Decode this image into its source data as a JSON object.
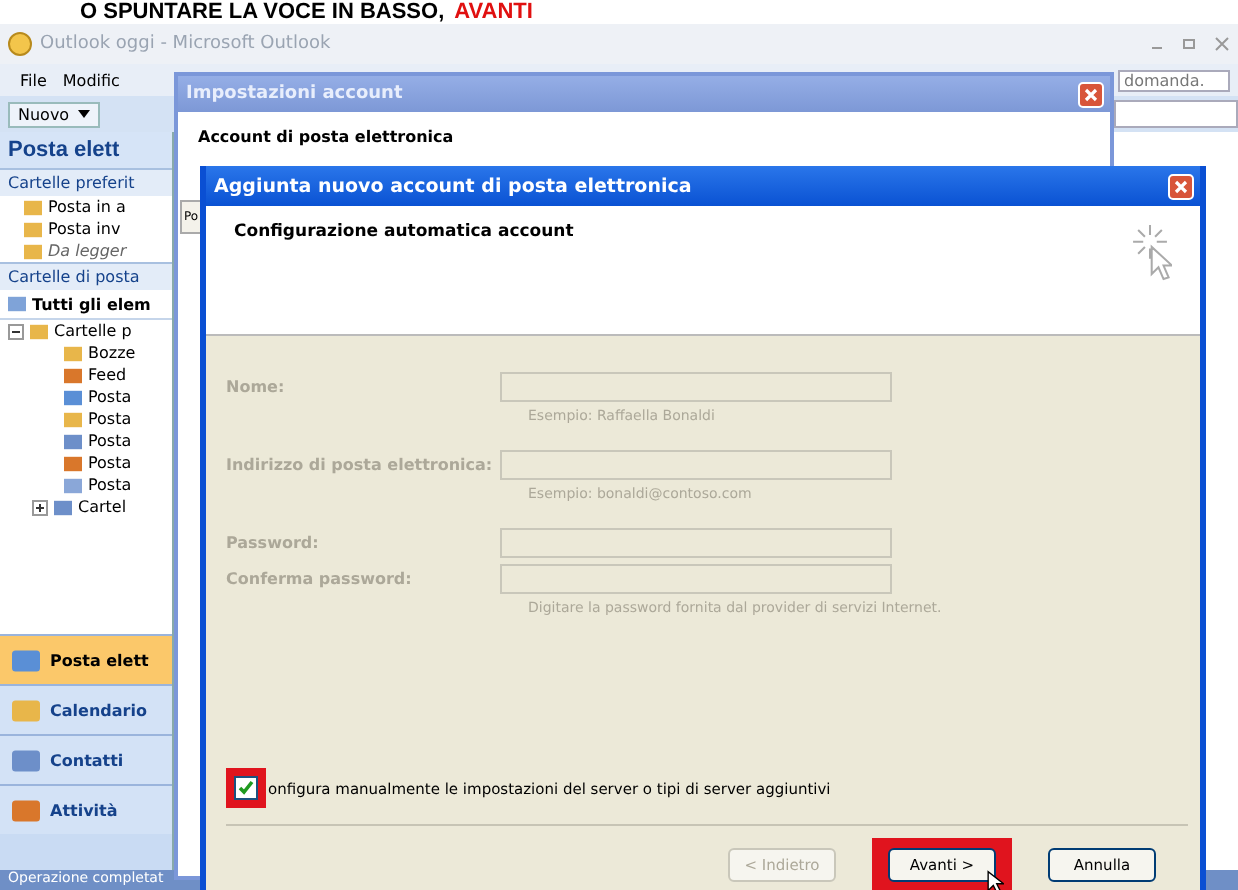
{
  "caption": {
    "text": "O SPUNTARE LA VOCE IN BASSO,",
    "highlight": "AVANTI"
  },
  "outlook": {
    "title": "Outlook oggi - Microsoft Outlook",
    "menu": [
      "File",
      "Modific"
    ],
    "help_box": "domanda.",
    "new_button": "Nuovo",
    "nav": {
      "title": "Posta elett",
      "favorites_header": "Cartelle preferit",
      "favorites": [
        {
          "label": "Posta in a",
          "italic": false
        },
        {
          "label": "Posta inv",
          "italic": false
        },
        {
          "label": "Da legger",
          "italic": true
        }
      ],
      "mail_header": "Cartelle di posta",
      "all_items": "Tutti gli elem",
      "tree": [
        {
          "label": "Cartelle p",
          "expanded": true,
          "children": [
            {
              "label": "Bozze"
            },
            {
              "label": "Feed"
            },
            {
              "label": "Posta"
            },
            {
              "label": "Posta"
            },
            {
              "label": "Posta"
            },
            {
              "label": "Posta"
            },
            {
              "label": "Posta"
            },
            {
              "label": "Cartel",
              "expanded": false
            }
          ]
        }
      ],
      "buttons": [
        {
          "label": "Posta elett",
          "selected": true
        },
        {
          "label": "Calendario",
          "selected": false
        },
        {
          "label": "Contatti",
          "selected": false
        },
        {
          "label": "Attività",
          "selected": false
        }
      ]
    },
    "status_bar": "Operazione completat"
  },
  "account_settings": {
    "title": "Impostazioni account",
    "heading": "Account di posta elettronica",
    "tab": "Po"
  },
  "dialog": {
    "title": "Aggiunta nuovo account di posta elettronica",
    "header": "Configurazione automatica account",
    "disabled": true,
    "fields": [
      {
        "label": "Nome:",
        "hint": "Esempio: Raffaella Bonaldi"
      },
      {
        "label": "Indirizzo di posta elettronica:",
        "hint": "Esempio: bonaldi@contoso.com"
      },
      {
        "label": "Password:"
      },
      {
        "label": "Conferma password:",
        "hint": "Digitare la password fornita dal provider di servizi Internet."
      }
    ],
    "manual": {
      "label": "onfigura manualmente le impostazioni del server o tipi di server aggiuntivi",
      "checked": true,
      "highlighted": true
    },
    "buttons": [
      {
        "label": "< Indietro",
        "disabled": true,
        "highlighted": false
      },
      {
        "label": "Avanti >",
        "disabled": false,
        "highlighted": true
      },
      {
        "label": "Annulla",
        "disabled": false,
        "highlighted": false
      }
    ]
  }
}
